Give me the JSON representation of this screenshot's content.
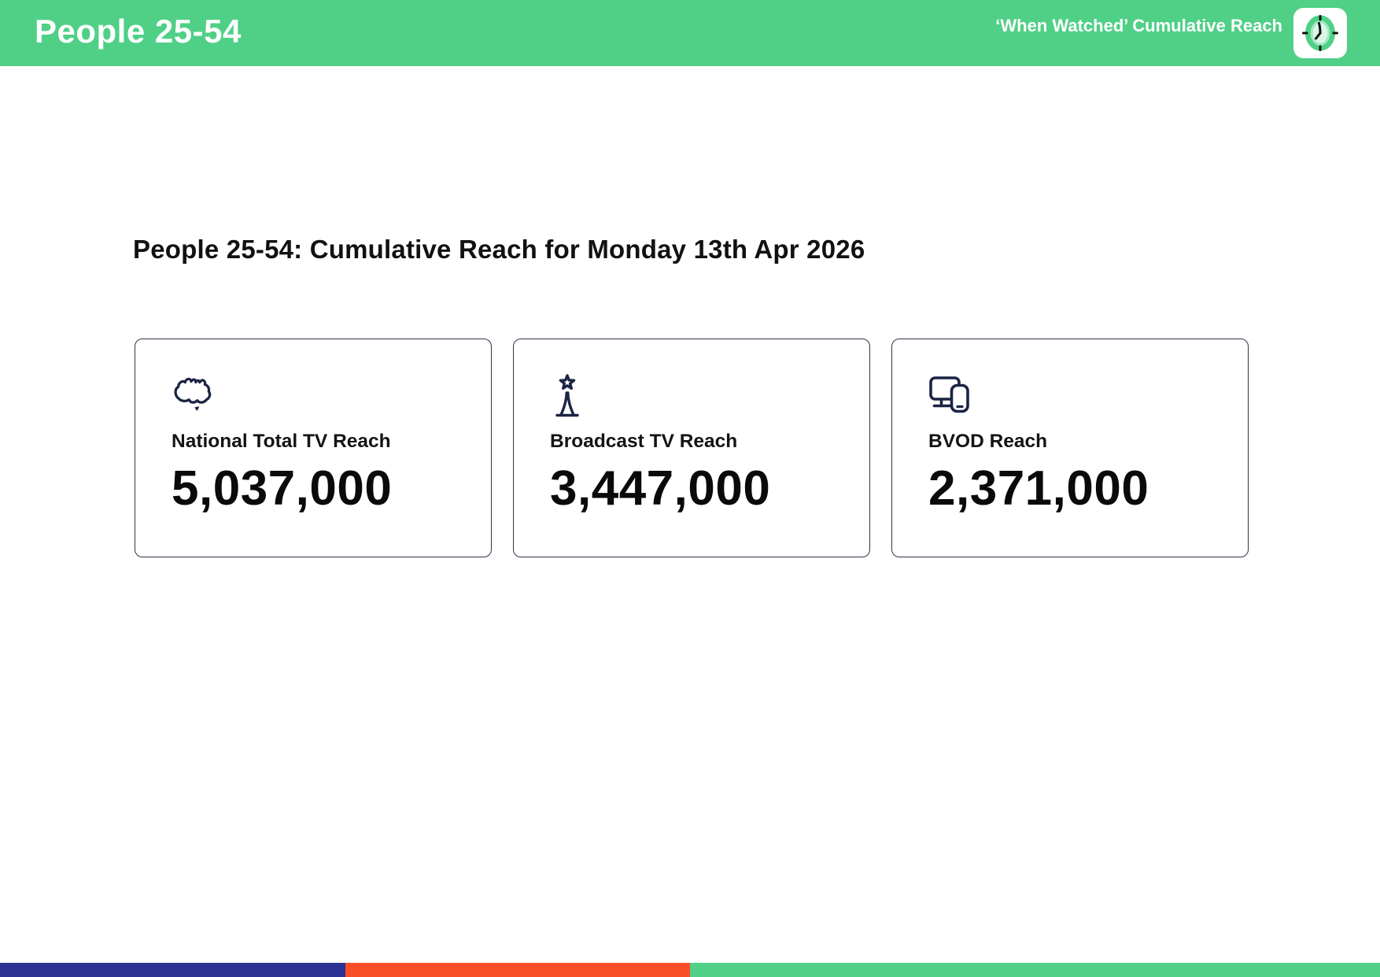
{
  "header": {
    "title": "People 25-54",
    "tagline": "‘When Watched’ Cumulative Reach",
    "logo_icon": "clock-icon"
  },
  "main": {
    "heading": "People 25-54: Cumulative Reach for Monday 13th Apr 2026",
    "cards": [
      {
        "icon": "australia-map-icon",
        "label": "National Total TV Reach",
        "value": "5,037,000"
      },
      {
        "icon": "broadcast-tower-icon",
        "label": "Broadcast TV Reach",
        "value": "3,447,000"
      },
      {
        "icon": "screens-devices-icon",
        "label": "BVOD Reach",
        "value": "2,371,000"
      }
    ]
  },
  "colors": {
    "brand_green": "#4fd086",
    "icon_navy": "#1b2444",
    "card_border": "#2c3547",
    "footer_blue": "#2d3392",
    "footer_orange": "#fa4f26",
    "footer_green": "#4fd086"
  },
  "footer": {
    "segments": [
      {
        "name": "blue",
        "color": "#2d3392",
        "width_pct": 25
      },
      {
        "name": "orange",
        "color": "#fa4f26",
        "width_pct": 25
      },
      {
        "name": "green",
        "color": "#4fd086",
        "width_pct": 50
      }
    ]
  }
}
